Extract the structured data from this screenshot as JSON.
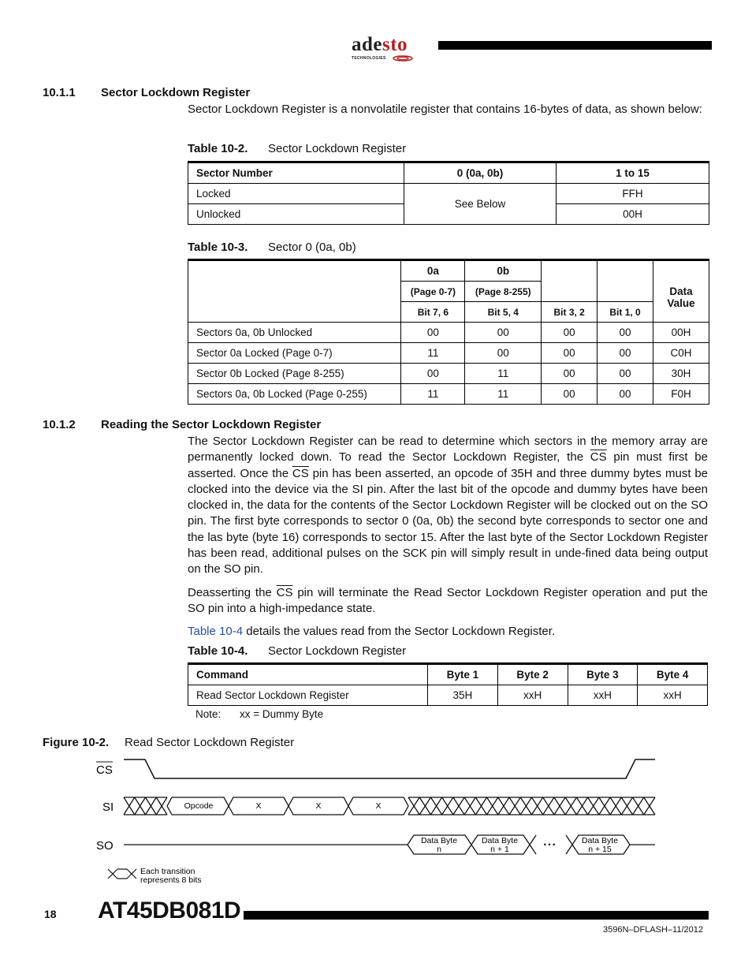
{
  "header": {
    "logo": {
      "word_part1": "ade",
      "word_part2": "sto",
      "subtitle": "TECHNOLOGIES"
    }
  },
  "section_1": {
    "number": "10.1.1",
    "title": "Sector Lockdown Register",
    "intro": "Sector Lockdown Register is a nonvolatile register that contains 16-bytes of data, as shown below:"
  },
  "table_10_2": {
    "label": "Table 10-2.",
    "title": "Sector Lockdown Register",
    "headers": [
      "Sector Number",
      "0 (0a, 0b)",
      "1 to 15"
    ],
    "rows": [
      {
        "name": "Locked",
        "sector0": "See Below",
        "sector1_15": "FFH"
      },
      {
        "name": "Unlocked",
        "sector1_15": "00H"
      }
    ]
  },
  "table_10_3": {
    "label": "Table 10-3.",
    "title": "Sector 0 (0a, 0b)",
    "header": {
      "col_0a": "0a",
      "col_0b": "0b",
      "page_0a": "(Page 0-7)",
      "page_0b": "(Page 8-255)",
      "bits_76": "Bit 7, 6",
      "bits_54": "Bit 5, 4",
      "bits_32": "Bit 3, 2",
      "bits_10": "Bit 1, 0",
      "data_value": "Data Value"
    },
    "rows": [
      {
        "name": "Sectors 0a, 0b Unlocked",
        "b76": "00",
        "b54": "00",
        "b32": "00",
        "b10": "00",
        "value": "00H"
      },
      {
        "name": "Sector 0a Locked (Page 0-7)",
        "b76": "11",
        "b54": "00",
        "b32": "00",
        "b10": "00",
        "value": "C0H"
      },
      {
        "name": "Sector 0b Locked (Page 8-255)",
        "b76": "00",
        "b54": "11",
        "b32": "00",
        "b10": "00",
        "value": "30H"
      },
      {
        "name": "Sectors 0a, 0b Locked (Page 0-255)",
        "b76": "11",
        "b54": "11",
        "b32": "00",
        "b10": "00",
        "value": "F0H"
      }
    ]
  },
  "section_2": {
    "number": "10.1.2",
    "title": "Reading the Sector Lockdown Register",
    "p1": {
      "a": "The Sector Lockdown Register can be read to determine which sectors in the memory array are permanently locked down. To read the Sector Lockdown Register, the ",
      "cs1": "CS",
      "b": " pin must first be asserted. Once the ",
      "cs2": "CS",
      "c": " pin has been asserted, an opcode of 35H and three dummy bytes must be clocked into the device via the SI pin. After the last bit of the opcode and dummy bytes have been clocked in, the data for the contents of the Sector Lockdown Register will be clocked out on the SO pin. The first byte corresponds to sector 0 (0a, 0b) the second byte corresponds to sector one and the las byte (byte 16) corresponds to sector 15. After the last byte of the Sector Lockdown Register has been read, additional pulses on the SCK pin will simply result in unde-fined data being output on the SO pin."
    },
    "p2": {
      "a": "Deasserting the ",
      "cs": "CS",
      "b": " pin will terminate the Read Sector Lockdown Register operation and put the SO pin into a high-impedance state."
    },
    "p3": {
      "link": "Table 10-4",
      "rest": " details the values read from the Sector Lockdown Register."
    }
  },
  "table_10_4": {
    "label": "Table 10-4.",
    "title": "Sector Lockdown Register",
    "headers": [
      "Command",
      "Byte 1",
      "Byte 2",
      "Byte 3",
      "Byte 4"
    ],
    "rows": [
      {
        "command": "Read Sector Lockdown Register",
        "byte1": "35H",
        "byte2": "xxH",
        "byte3": "xxH",
        "byte4": "xxH"
      }
    ],
    "note_label": "Note:",
    "note_text": "xx = Dummy Byte"
  },
  "figure_10_2": {
    "label": "Figure 10-2.",
    "title": "Read Sector Lockdown Register",
    "signals": {
      "cs": "CS",
      "si": "SI",
      "so": "SO"
    },
    "si_bytes": [
      "Opcode",
      "X",
      "X",
      "X"
    ],
    "so_bytes": [
      {
        "line1": "Data Byte",
        "line2": "n"
      },
      {
        "line1": "Data Byte",
        "line2": "n + 1"
      },
      {
        "line1": "Data Byte",
        "line2": "n + 15"
      }
    ],
    "ellipsis": "• • •",
    "legend_line1": "Each transition",
    "legend_line2": "represents 8 bits"
  },
  "footer": {
    "page_number": "18",
    "product": "AT45DB081D",
    "doc_id": "3596N–DFLASH–11/2012"
  }
}
